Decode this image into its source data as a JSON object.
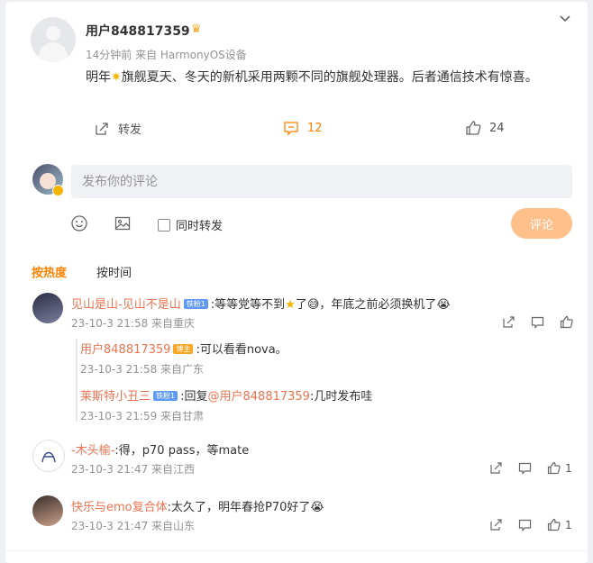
{
  "post": {
    "username": "用户848817359",
    "meta": "14分钟前 来自 HarmonyOS设备",
    "text_before": "明年",
    "text_after": "旗舰夏天、冬天的新机采用两颗不同的旗舰处理器。后者通信技术有惊喜。",
    "actions": {
      "repost_label": "转发",
      "comment_count": "12",
      "like_count": "24"
    }
  },
  "composer": {
    "placeholder": "发布你的评论",
    "repost_label": "同时转发",
    "submit_label": "评论"
  },
  "sort": {
    "hot": "按热度",
    "time": "按时间"
  },
  "comments": [
    {
      "name": "见山是山-见山不是山",
      "badge": "铁粉1",
      "text_a": ":等等党等不到",
      "text_b": "了",
      "text_c": "，年底之前必须换机了",
      "meta": "23-10-3 21:58 来自重庆",
      "replies": [
        {
          "name": "用户848817359",
          "badge": "博主",
          "text": ":可以看看nova。",
          "meta": "23-10-3 21:58 来自广东"
        },
        {
          "name": "莱斯特小丑三",
          "badge": "铁粉1",
          "text_prefix": ":回复",
          "mention": "@用户848817359",
          "text": ":几时发布哇",
          "meta": "23-10-3 21:59 来自甘肃"
        }
      ]
    },
    {
      "name": "-木头榆-",
      "text": ":得，p70 pass，等mate",
      "meta": "23-10-3 21:47 来自江西",
      "like_count": "1"
    },
    {
      "name": "快乐与emo复合体",
      "text": ":太久了，明年春抢P70好了",
      "meta": "23-10-3 21:47 来自山东",
      "like_count": "1"
    }
  ],
  "colors": {
    "accent": "#ff8200",
    "name": "#eb7350",
    "submit_disabled": "#ffc08c"
  }
}
